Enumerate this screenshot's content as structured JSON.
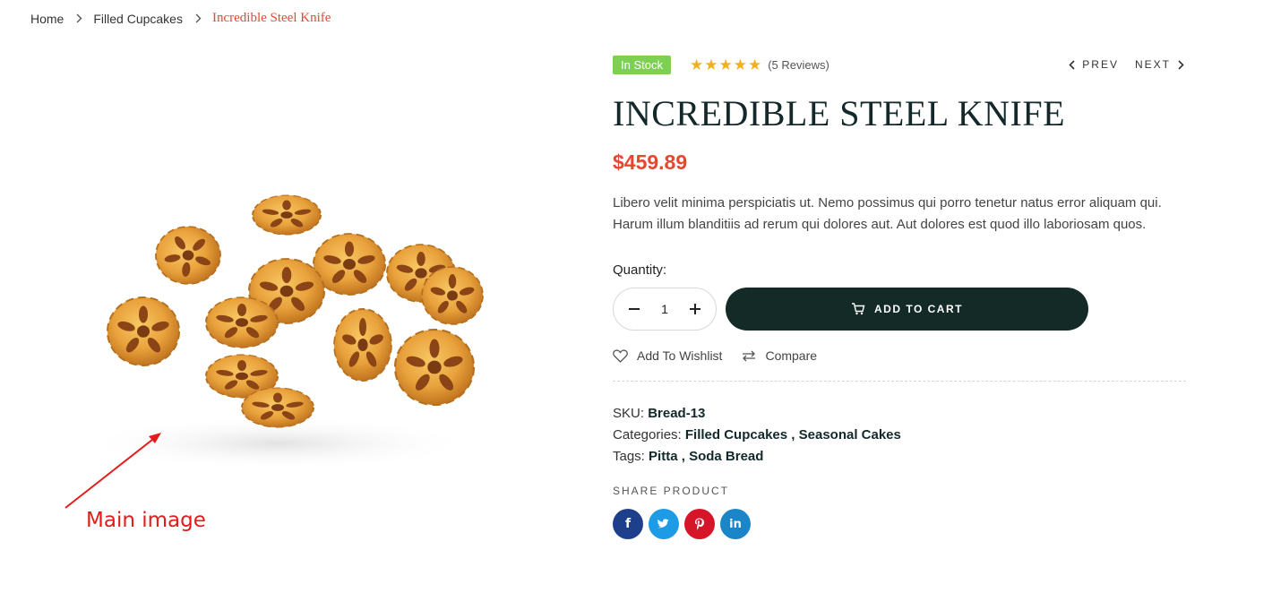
{
  "breadcrumb": {
    "home": "Home",
    "category": "Filled Cupcakes",
    "current": "Incredible Steel Knife"
  },
  "annotation": {
    "label": "Main image"
  },
  "product": {
    "stock_badge": "In Stock",
    "rating": 5,
    "rating_max": 5,
    "reviews": "(5 Reviews)",
    "prev": "PREV",
    "next": "NEXT",
    "title": "INCREDIBLE STEEL KNIFE",
    "price": "$459.89",
    "description": "Libero velit minima perspiciatis ut. Nemo possimus qui porro tenetur natus error aliquam qui. Harum illum blanditiis ad rerum qui dolores aut. Aut dolores est quod illo laboriosam quos.",
    "quantity_label": "Quantity:",
    "quantity": "1",
    "add_to_cart": "ADD TO CART",
    "wishlist": "Add To Wishlist",
    "compare": "Compare",
    "sku_label": "SKU:",
    "sku": "Bread-13",
    "categories_label": "Categories:",
    "categories": [
      "Filled Cupcakes",
      "Seasonal Cakes"
    ],
    "tags_label": "Tags:",
    "tags": [
      "Pitta",
      "Soda Bread"
    ],
    "share_label": "SHARE PRODUCT"
  },
  "share_buttons": [
    {
      "name": "facebook",
      "glyph": "f",
      "color": "#1e3f8c"
    },
    {
      "name": "twitter",
      "glyph": "t",
      "color": "#1d9be6"
    },
    {
      "name": "pinterest",
      "glyph": "p",
      "color": "#d61529"
    },
    {
      "name": "linkedin",
      "glyph": "in",
      "color": "#1a86c8"
    }
  ],
  "colors": {
    "accent": "#e8472f",
    "dark": "#132a26",
    "stock": "#7ed054",
    "star": "#f2b01e",
    "annotation": "#e31b1b"
  }
}
